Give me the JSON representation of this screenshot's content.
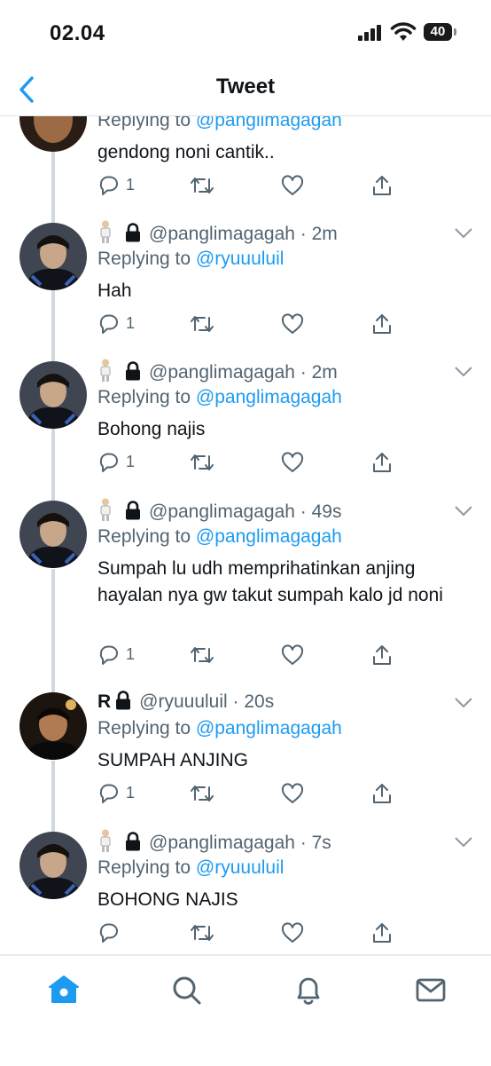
{
  "status_bar": {
    "time": "02.04",
    "battery": "40"
  },
  "header": {
    "title": "Tweet"
  },
  "colors": {
    "accent": "#1d9bf0",
    "secondary_text": "#536471",
    "line": "#cfd9de"
  },
  "tweets": [
    {
      "name": "",
      "handle": "",
      "time": "",
      "replying_prefix": "Replying to",
      "replying_to": "@panglimagagah",
      "text": "gendong noni cantik..",
      "reply_count": "1"
    },
    {
      "name": "",
      "handle": "@panglimagagah",
      "time": "· 2m",
      "replying_prefix": "Replying to",
      "replying_to": "@ryuuuluil",
      "text": "Hah",
      "reply_count": "1"
    },
    {
      "name": "",
      "handle": "@panglimagagah",
      "time": "· 2m",
      "replying_prefix": "Replying to",
      "replying_to": "@panglimagagah",
      "text": "Bohong najis",
      "reply_count": "1"
    },
    {
      "name": "",
      "handle": "@panglimagagah",
      "time": "· 49s",
      "replying_prefix": "Replying to",
      "replying_to": "@panglimagagah",
      "text": "Sumpah lu udh memprihatinkan anjing hayalan nya gw takut sumpah kalo jd noni",
      "reply_count": "1"
    },
    {
      "name": "R",
      "handle": "@ryuuuluil",
      "time": "· 20s",
      "replying_prefix": "Replying to",
      "replying_to": "@panglimagagah",
      "text": "SUMPAH ANJING",
      "reply_count": "1"
    },
    {
      "name": "",
      "handle": "@panglimagagah",
      "time": "· 7s",
      "replying_prefix": "Replying to",
      "replying_to": "@ryuuuluil",
      "text": "BOHONG NAJIS",
      "reply_count": ""
    }
  ],
  "tab_bar": {
    "icons": [
      "home-icon",
      "search-icon",
      "notifications-icon",
      "messages-icon"
    ]
  }
}
